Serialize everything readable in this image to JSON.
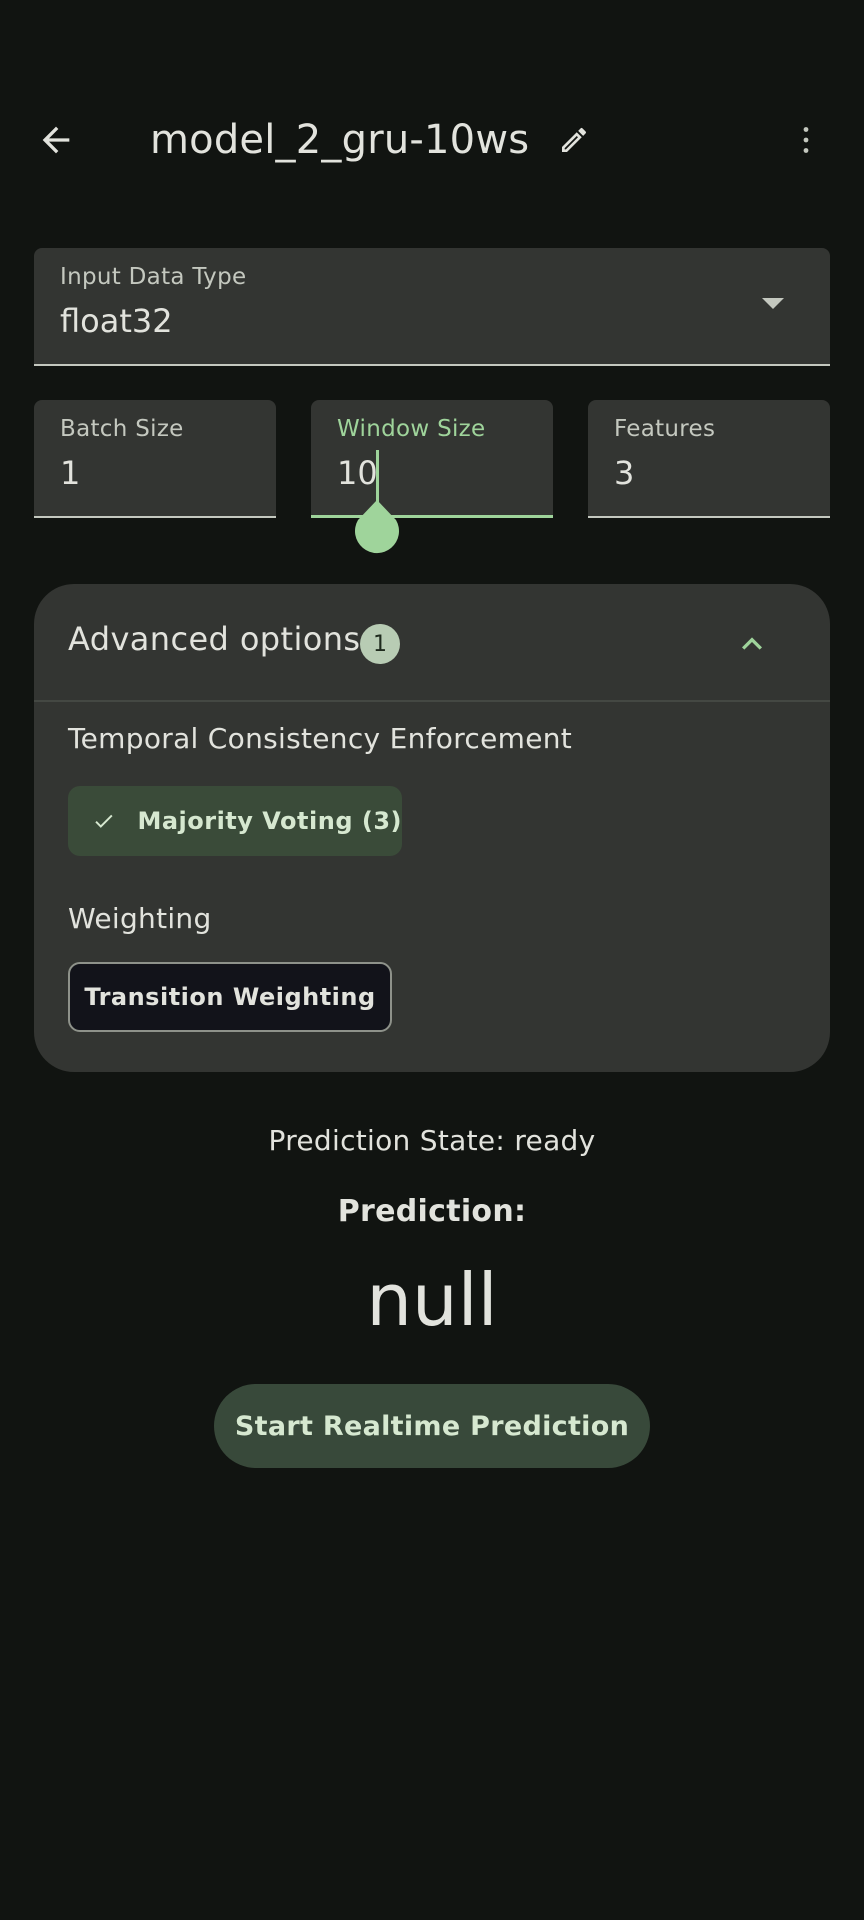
{
  "app_bar": {
    "title": "model_2_gru-10ws"
  },
  "input_type": {
    "label": "Input Data Type",
    "value": "float32"
  },
  "shape_fields": [
    {
      "label": "Batch Size",
      "value": "1"
    },
    {
      "label": "Window Size",
      "value": "10"
    },
    {
      "label": "Features",
      "value": "3"
    }
  ],
  "advanced": {
    "title": "Advanced options",
    "badge": "1",
    "temporal_label": "Temporal Consistency Enforcement",
    "temporal_chip": "Majority Voting (3)",
    "weighting_label": "Weighting",
    "weighting_chip": "Transition Weighting"
  },
  "prediction": {
    "state_text": "Prediction State: ready",
    "label": "Prediction:",
    "value": "null"
  },
  "start_button": "Start Realtime Prediction",
  "colors": {
    "background": "#111411",
    "surface": "#333532",
    "accent": "#9fd49b",
    "chip_selected": "#3a4b39"
  }
}
